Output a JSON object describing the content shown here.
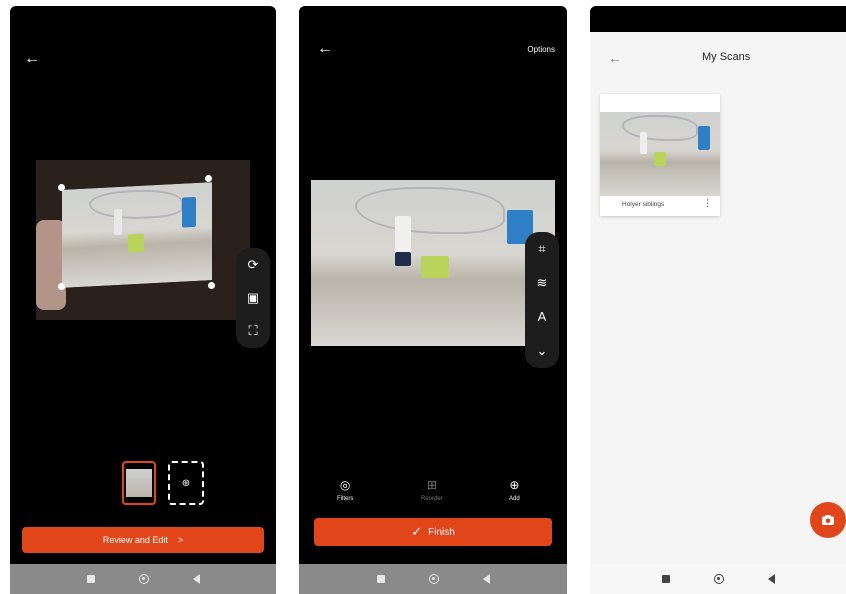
{
  "screen1": {
    "review_button": "Review and Edit",
    "review_chevron": ">"
  },
  "screen2": {
    "options": "Options",
    "tools": [
      "Filters",
      "Reorder",
      "Add"
    ],
    "finish": "Finish"
  },
  "screen3": {
    "title": "My Scans",
    "scan_name": "Holyer siblings",
    "menu_glyph": "⋮"
  },
  "icons": {
    "back": "←"
  },
  "colors": {
    "accent": "#e0461a"
  }
}
